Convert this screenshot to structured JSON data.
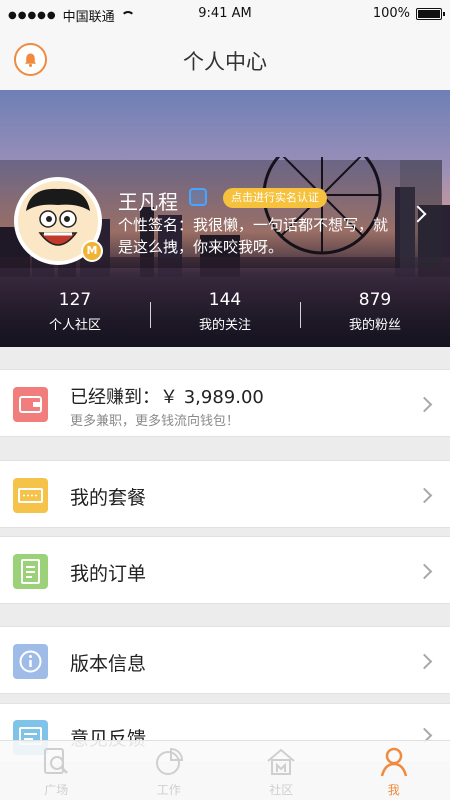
{
  "status_bar": {
    "signal": "●●●●●",
    "carrier": "中国联通",
    "time": "9:41 AM",
    "battery": "100%",
    "battery_level": 1.0
  },
  "header": {
    "title": "个人中心",
    "bell_icon": "bell-icon"
  },
  "profile": {
    "username": "王凡程",
    "verify_label": "点击进行实名认证",
    "member_badge": "M",
    "signature": "个性签名：我很懒，一句话都不想写，就是这么拽，你来咬我呀。",
    "stats": [
      {
        "value": "127",
        "label": "个人社区"
      },
      {
        "value": "144",
        "label": "我的关注"
      },
      {
        "value": "879",
        "label": "我的粉丝"
      }
    ]
  },
  "menu": {
    "earnings": {
      "label": "已经赚到：￥ 3,989.00",
      "sub": "更多兼职，更多钱流向钱包！",
      "icon": "wallet-icon",
      "color": "#f27d7d"
    },
    "package": {
      "label": "我的套餐",
      "icon": "ticket-icon",
      "color": "#f6c34a"
    },
    "order": {
      "label": "我的订单",
      "icon": "document-icon",
      "color": "#9bd179"
    },
    "version": {
      "label": "版本信息",
      "icon": "info-icon",
      "color": "#9fbbe8"
    },
    "feedback": {
      "label": "意见反馈",
      "icon": "feedback-icon",
      "color": "#7fc3e8"
    }
  },
  "tabs": [
    {
      "label": "广场",
      "icon": "search-doc-icon",
      "active": false
    },
    {
      "label": "工作",
      "icon": "pie-chart-icon",
      "active": false
    },
    {
      "label": "社区",
      "icon": "home-icon",
      "active": false
    },
    {
      "label": "我",
      "icon": "person-icon",
      "active": true
    }
  ],
  "colors": {
    "accent": "#f08a3e",
    "background": "#ececec"
  }
}
